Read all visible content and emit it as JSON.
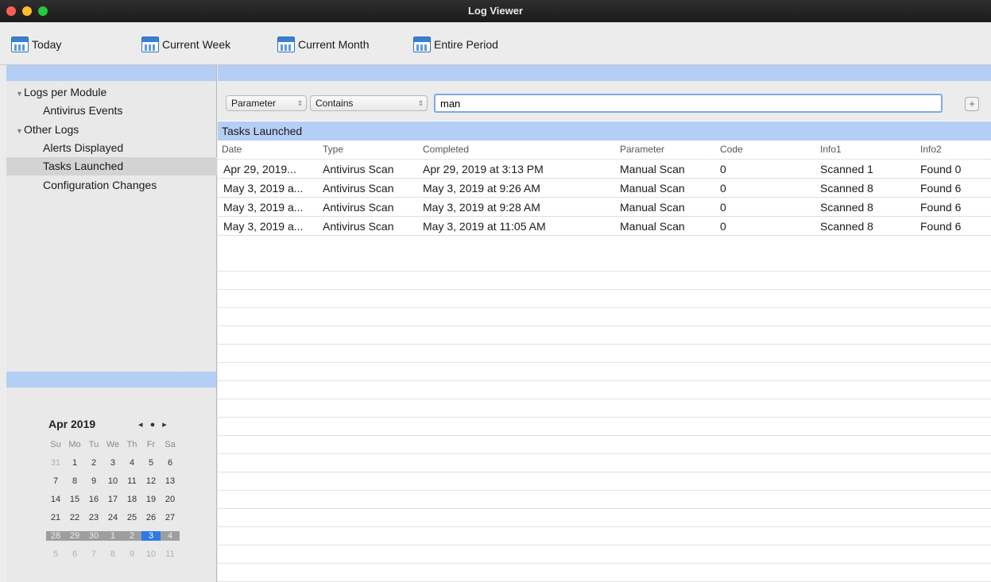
{
  "window": {
    "title": "Log Viewer"
  },
  "toolbar": {
    "today": "Today",
    "current_week": "Current Week",
    "current_month": "Current Month",
    "entire_period": "Entire Period"
  },
  "sidebar": {
    "groups": [
      {
        "label": "Logs per Module",
        "items": [
          "Antivirus Events"
        ]
      },
      {
        "label": "Other Logs",
        "items": [
          "Alerts Displayed",
          "Tasks Launched",
          "Configuration Changes"
        ]
      }
    ],
    "selected": "Tasks Launched"
  },
  "calendar": {
    "month_label": "Apr 2019",
    "nav": "◂ ● ▸",
    "weekdays": [
      "Su",
      "Mo",
      "Tu",
      "We",
      "Th",
      "Fr",
      "Sa"
    ],
    "weeks": [
      [
        "31",
        "1",
        "2",
        "3",
        "4",
        "5",
        "6"
      ],
      [
        "7",
        "8",
        "9",
        "10",
        "11",
        "12",
        "13"
      ],
      [
        "14",
        "15",
        "16",
        "17",
        "18",
        "19",
        "20"
      ],
      [
        "21",
        "22",
        "23",
        "24",
        "25",
        "26",
        "27"
      ],
      [
        "28",
        "29",
        "30",
        "1",
        "2",
        "3",
        "4"
      ],
      [
        "5",
        "6",
        "7",
        "8",
        "9",
        "10",
        "11"
      ]
    ]
  },
  "filter": {
    "field": "Parameter",
    "operator": "Contains",
    "value": "man",
    "add_label": "+"
  },
  "table": {
    "title": "Tasks Launched",
    "columns": [
      "Date",
      "Type",
      "Completed",
      "Parameter",
      "Code",
      "Info1",
      "Info2"
    ],
    "rows": [
      [
        "Apr 29, 2019...",
        "Antivirus Scan",
        "Apr 29, 2019 at 3:13 PM",
        "Manual Scan",
        "0",
        "Scanned 1",
        "Found 0"
      ],
      [
        "May 3, 2019 a...",
        "Antivirus Scan",
        "May 3, 2019 at 9:26 AM",
        "Manual Scan",
        "0",
        "Scanned 8",
        "Found 6"
      ],
      [
        "May 3, 2019 a...",
        "Antivirus Scan",
        "May 3, 2019 at 9:28 AM",
        "Manual Scan",
        "0",
        "Scanned 8",
        "Found 6"
      ],
      [
        "May 3, 2019 a...",
        "Antivirus Scan",
        "May 3, 2019 at 11:05 AM",
        "Manual Scan",
        "0",
        "Scanned 8",
        "Found 6"
      ]
    ]
  }
}
